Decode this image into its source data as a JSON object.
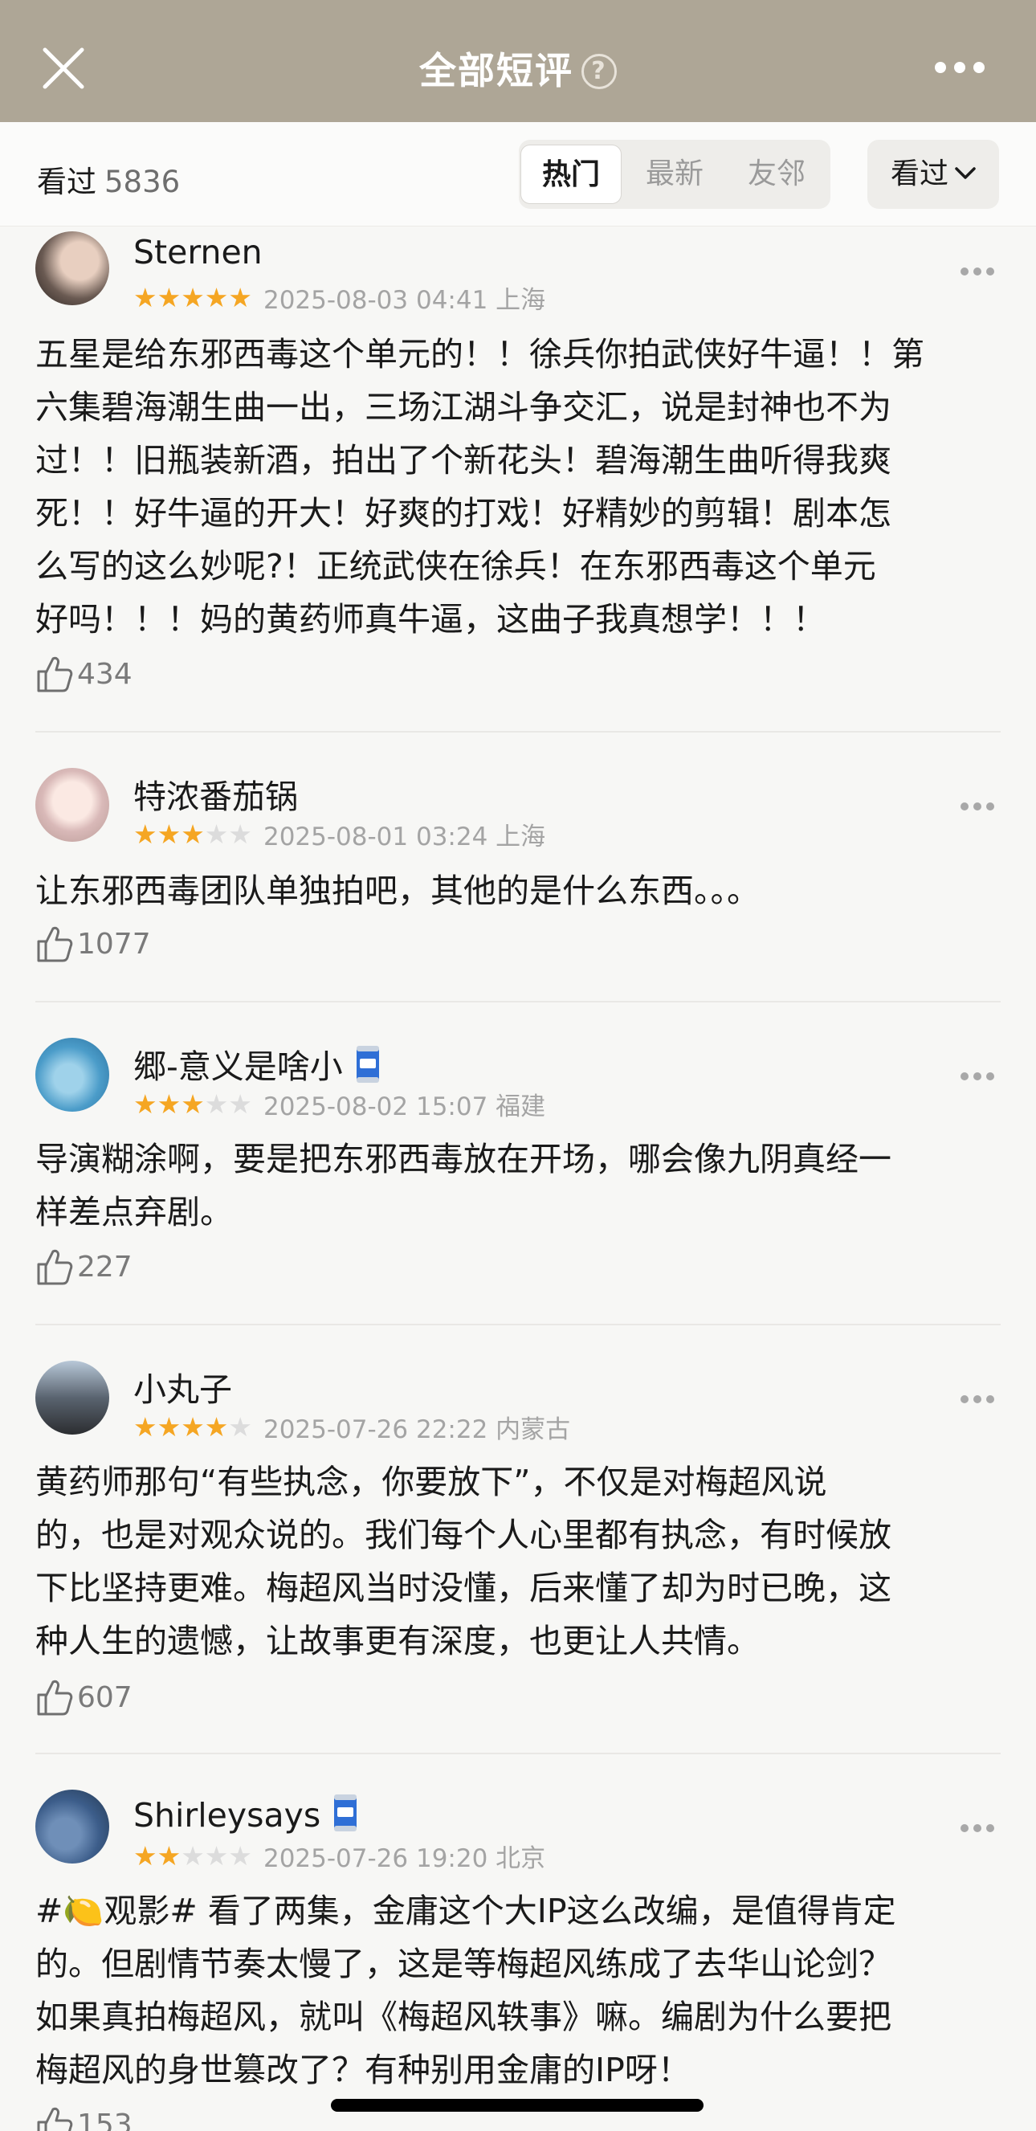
{
  "header": {
    "title": "全部短评",
    "help_icon": "question-circle-icon",
    "close_icon": "close-icon",
    "more_icon": "more-horizontal-icon"
  },
  "filter": {
    "seen_label": "看过",
    "seen_count": "5836",
    "tabs": [
      {
        "label": "热门",
        "active": true
      },
      {
        "label": "最新",
        "active": false
      },
      {
        "label": "友邻",
        "active": false
      }
    ],
    "dropdown_label": "看过",
    "dropdown_icon": "chevron-down-icon"
  },
  "colors": {
    "header_bg": "#aea696",
    "star_on": "#f5a623",
    "star_off": "#dcdcdc",
    "page_bg": "#f7f7f5"
  },
  "reviews": [
    {
      "username": "Sternen",
      "badge": false,
      "rating": 5,
      "date": "2025-08-03 04:41 上海",
      "content": "五星是给东邪西毒这个单元的！！徐兵你拍武侠好牛逼！！第\n六集碧海潮生曲一出，三场江湖斗争交汇，说是封神也不为\n过！！旧瓶装新酒，拍出了个新花头！碧海潮生曲听得我爽\n死！！好牛逼的开大！好爽的打戏！好精妙的剪辑！剧本怎\n么写的这么妙呢?！正统武侠在徐兵！在东邪西毒这个单元\n好吗！！！妈的黄药师真牛逼，这曲子我真想学！！！",
      "likes": "434"
    },
    {
      "username": "特浓番茄锅",
      "badge": false,
      "rating": 3,
      "date": "2025-08-01 03:24 上海",
      "content": "让东邪西毒团队单独拍吧，其他的是什么东西。。。",
      "likes": "1077"
    },
    {
      "username": "郷-意义是啥小",
      "badge": true,
      "rating": 3,
      "date": "2025-08-02 15:07 福建",
      "content": "导演糊涂啊，要是把东邪西毒放在开场，哪会像九阴真经一\n样差点弃剧。",
      "likes": "227"
    },
    {
      "username": "小丸子",
      "badge": false,
      "rating": 4,
      "date": "2025-07-26 22:22 内蒙古",
      "content": "黄药师那句“有些执念，你要放下”，不仅是对梅超风说\n的，也是对观众说的。我们每个人心里都有执念，有时候放\n下比坚持更难。梅超风当时没懂，后来懂了却为时已晚，这\n种人生的遗憾，让故事更有深度，也更让人共情。",
      "likes": "607"
    },
    {
      "username": "Shirleysays",
      "badge": true,
      "rating": 2,
      "date": "2025-07-26 19:20 北京",
      "content": "#🍋观影# 看了两集，金庸这个大IP这么改编，是值得肯定\n的。但剧情节奏太慢了，这是等梅超风练成了去华山论剑？\n如果真拍梅超风，就叫《梅超风轶事》嘛。编剧为什么要把\n梅超风的身世篡改了？有种别用金庸的IP呀！",
      "likes": "153"
    }
  ]
}
